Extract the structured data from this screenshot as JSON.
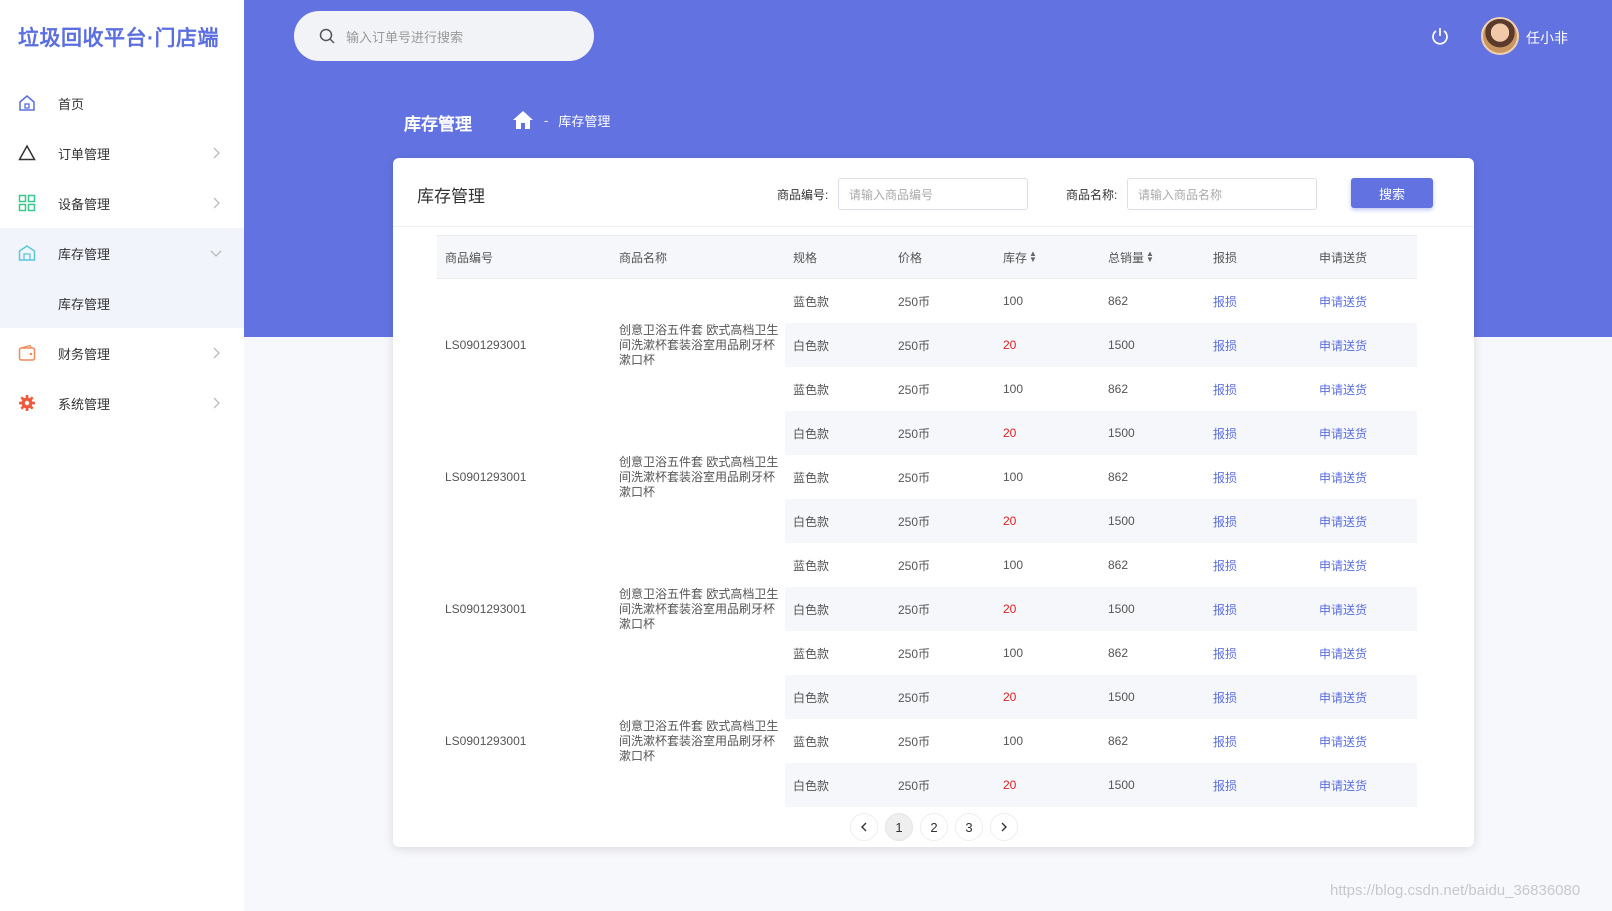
{
  "app": {
    "title": "垃圾回收平台·门店端"
  },
  "sidebar": {
    "items": [
      {
        "label": "首页",
        "icon": "home-icon",
        "color": "#5b6fe0",
        "has_arrow": false
      },
      {
        "label": "订单管理",
        "icon": "triangle-icon",
        "color": "#333333",
        "has_arrow": true
      },
      {
        "label": "设备管理",
        "icon": "grid-icon",
        "color": "#3cc690",
        "has_arrow": true
      },
      {
        "label": "库存管理",
        "icon": "warehouse-icon",
        "color": "#5bc7d8",
        "has_arrow": true,
        "expanded": true
      },
      {
        "label": "财务管理",
        "icon": "wallet-icon",
        "color": "#f08a5a",
        "has_arrow": true
      },
      {
        "label": "系统管理",
        "icon": "gear-icon",
        "color": "#f05a3c",
        "has_arrow": true
      }
    ],
    "submenu": [
      {
        "label": "库存管理"
      }
    ]
  },
  "header": {
    "search_placeholder": "输入订单号进行搜索",
    "user_name": "任小非",
    "page_title": "库存管理",
    "breadcrumb_sep": "-",
    "breadcrumb": "库存管理"
  },
  "card": {
    "title": "库存管理",
    "filter_code_label": "商品编号:",
    "filter_code_placeholder": "请输入商品编号",
    "filter_name_label": "商品名称:",
    "filter_name_placeholder": "请输入商品名称",
    "search_label": "搜索"
  },
  "table": {
    "columns": [
      "商品编号",
      "商品名称",
      "规格",
      "价格",
      "库存",
      "总销量",
      "报损",
      "申请送货"
    ],
    "groups": [
      {
        "code": "LS0901293001",
        "name": "创意卫浴五件套 欧式高档卫生间洗漱杯套装浴室用品刷牙杯漱口杯",
        "rows": [
          {
            "spec": "蓝色款",
            "price": "250币",
            "stock": "100",
            "sales": "862",
            "damage": "报损",
            "deliver": "申请送货",
            "low": false
          },
          {
            "spec": "白色款",
            "price": "250币",
            "stock": "20",
            "sales": "1500",
            "damage": "报损",
            "deliver": "申请送货",
            "low": true
          },
          {
            "spec": "蓝色款",
            "price": "250币",
            "stock": "100",
            "sales": "862",
            "damage": "报损",
            "deliver": "申请送货",
            "low": false
          }
        ]
      },
      {
        "code": "LS0901293001",
        "name": "创意卫浴五件套 欧式高档卫生间洗漱杯套装浴室用品刷牙杯漱口杯",
        "rows": [
          {
            "spec": "白色款",
            "price": "250币",
            "stock": "20",
            "sales": "1500",
            "damage": "报损",
            "deliver": "申请送货",
            "low": true
          },
          {
            "spec": "蓝色款",
            "price": "250币",
            "stock": "100",
            "sales": "862",
            "damage": "报损",
            "deliver": "申请送货",
            "low": false
          },
          {
            "spec": "白色款",
            "price": "250币",
            "stock": "20",
            "sales": "1500",
            "damage": "报损",
            "deliver": "申请送货",
            "low": true
          }
        ]
      },
      {
        "code": "LS0901293001",
        "name": "创意卫浴五件套 欧式高档卫生间洗漱杯套装浴室用品刷牙杯漱口杯",
        "rows": [
          {
            "spec": "蓝色款",
            "price": "250币",
            "stock": "100",
            "sales": "862",
            "damage": "报损",
            "deliver": "申请送货",
            "low": false
          },
          {
            "spec": "白色款",
            "price": "250币",
            "stock": "20",
            "sales": "1500",
            "damage": "报损",
            "deliver": "申请送货",
            "low": true
          },
          {
            "spec": "蓝色款",
            "price": "250币",
            "stock": "100",
            "sales": "862",
            "damage": "报损",
            "deliver": "申请送货",
            "low": false
          }
        ]
      },
      {
        "code": "LS0901293001",
        "name": "创意卫浴五件套 欧式高档卫生间洗漱杯套装浴室用品刷牙杯漱口杯",
        "rows": [
          {
            "spec": "白色款",
            "price": "250币",
            "stock": "20",
            "sales": "1500",
            "damage": "报损",
            "deliver": "申请送货",
            "low": true
          },
          {
            "spec": "蓝色款",
            "price": "250币",
            "stock": "100",
            "sales": "862",
            "damage": "报损",
            "deliver": "申请送货",
            "low": false
          },
          {
            "spec": "白色款",
            "price": "250币",
            "stock": "20",
            "sales": "1500",
            "damage": "报损",
            "deliver": "申请送货",
            "low": true
          }
        ]
      }
    ]
  },
  "pagination": {
    "pages": [
      "1",
      "2",
      "3"
    ],
    "current": "1"
  },
  "watermark": "https://blog.csdn.net/baidu_36836080",
  "colors": {
    "primary": "#6273e1",
    "danger": "#e02020",
    "link": "#5b6fe0"
  }
}
